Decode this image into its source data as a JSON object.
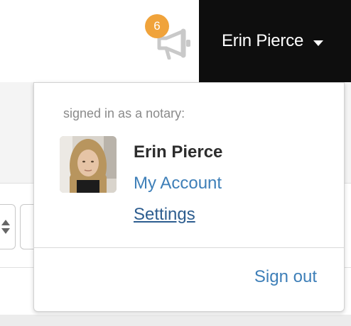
{
  "header": {
    "notification_count": "6",
    "user_name": "Erin Pierce"
  },
  "dropdown": {
    "signed_in_label": "signed in as a notary:",
    "profile_name": "Erin Pierce",
    "my_account_label": "My Account",
    "settings_label": "Settings",
    "sign_out_label": "Sign out"
  },
  "colors": {
    "header_bg": "#0e0e0e",
    "badge": "#f0a33b",
    "link": "#3e7fb8",
    "link_visited": "#2d5d8f"
  },
  "icons": {
    "announcement": "megaphone-icon",
    "menu": "caret-down-icon",
    "sort": "sort-arrows-icon"
  }
}
